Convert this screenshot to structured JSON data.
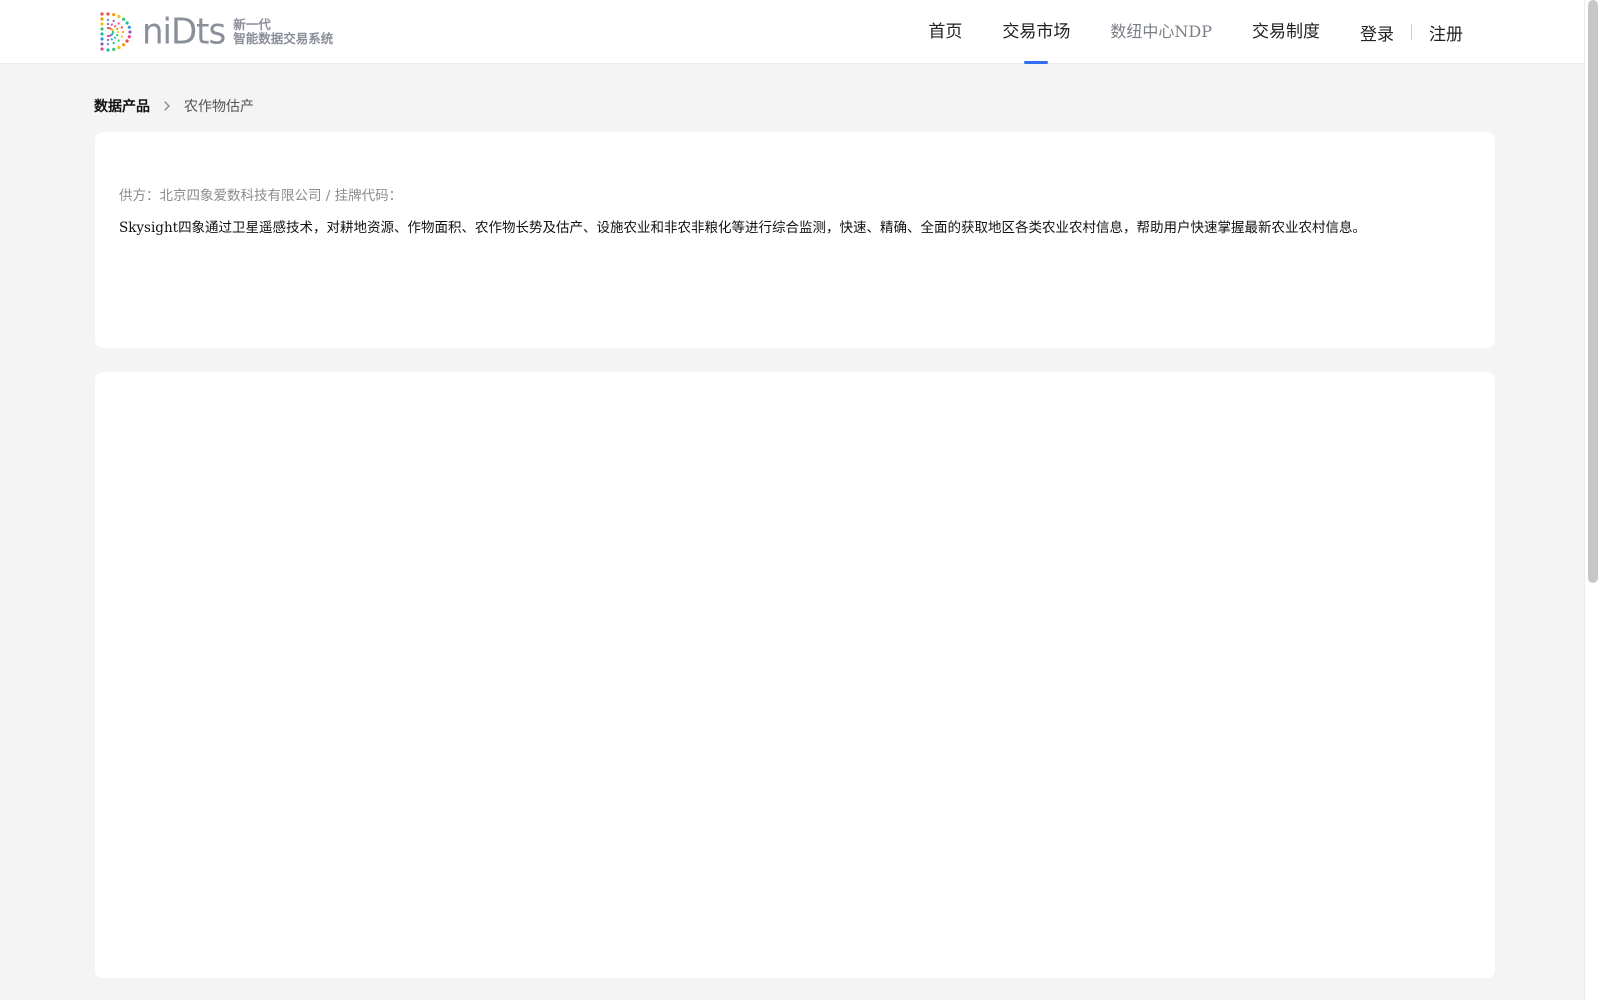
{
  "header": {
    "logo": {
      "word": "niDts",
      "tagline_line1": "新一代",
      "tagline_line2": "智能数据交易系统"
    },
    "nav": [
      {
        "label": "首页",
        "active": false
      },
      {
        "label": "交易市场",
        "active": true
      },
      {
        "label": "数纽中心NDP",
        "active": false
      },
      {
        "label": "交易制度",
        "active": false
      }
    ],
    "login_label": "登录",
    "register_label": "注册",
    "accent_color": "#2f6ff1"
  },
  "breadcrumb": {
    "root": "数据产品",
    "current": "农作物估产",
    "separator_icon": "chevron-right-icon"
  },
  "product": {
    "supplier_line": "供方：北京四象爱数科技有限公司 / 挂牌代码：",
    "description": "Skysight四象通过卫星遥感技术，对耕地资源、作物面积、农作物长势及估产、设施农业和非农非粮化等进行综合监测，快速、精确、全面的获取地区各类农业农村信息，帮助用户快速掌握最新农业农村信息。"
  }
}
